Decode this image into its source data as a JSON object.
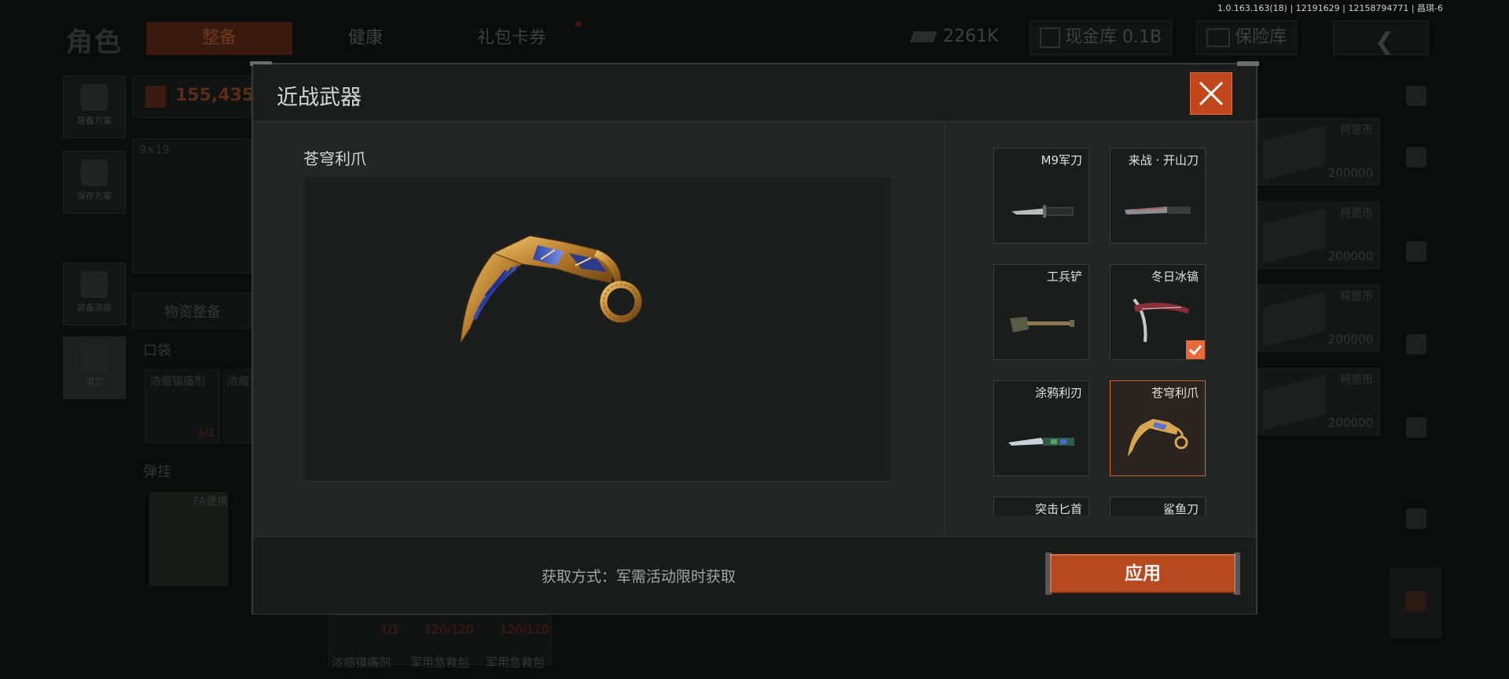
{
  "version_text": "1.0.163.163(18) | 12191629 | 12158794771 | 昌琪-6",
  "background": {
    "title": "角色",
    "tabs": [
      {
        "label": "整备",
        "active": true
      },
      {
        "label": "健康",
        "active": false
      },
      {
        "label": "礼包卡券",
        "active": false
      }
    ],
    "resources": {
      "ticket": "2261K",
      "cash_vault": "现金库 0.1B",
      "safe": "保险库"
    },
    "currency_value": "155,435",
    "ammo_label": "9×19",
    "side_buttons": [
      "装备方案",
      "保存方案",
      "装备涂装",
      "潜力"
    ],
    "supply_tab": "物资整备",
    "pocket_label": "口袋",
    "pocket_items": [
      {
        "name": "浓缩镇痛剂",
        "count": "1/1"
      },
      {
        "name": "浓缩",
        "count": ""
      }
    ],
    "rig_label": "弹挂",
    "rig_name": "FA便携",
    "bottom_items": [
      {
        "name": "浓缩镇痛剂",
        "count": "1/1"
      },
      {
        "name": "军用急救包",
        "count": "120/120"
      },
      {
        "name": "军用急救包",
        "count": "120/120"
      }
    ],
    "money_cards": [
      {
        "label": "柯恩币",
        "value": "200000"
      },
      {
        "label": "柯恩币",
        "value": "200000"
      },
      {
        "label": "柯恩币",
        "value": "200000"
      },
      {
        "label": "柯恩币",
        "value": "200000"
      }
    ]
  },
  "modal": {
    "title": "近战武器",
    "selected_name": "苍穹利爪",
    "weapons": [
      {
        "name": "M9军刀",
        "thumb": "bayonet"
      },
      {
        "name": "来战 · 开山刀",
        "thumb": "machete"
      },
      {
        "name": "工兵铲",
        "thumb": "shovel"
      },
      {
        "name": "冬日冰镐",
        "thumb": "icepick",
        "equipped": true
      },
      {
        "name": "涂鸦利刃",
        "thumb": "graffiti-knife"
      },
      {
        "name": "苍穹利爪",
        "thumb": "karambit",
        "selected": true
      },
      {
        "name": "突击匕首",
        "thumb": "dagger"
      },
      {
        "name": "鲨鱼刀",
        "thumb": "shark-knife"
      }
    ],
    "source_text": "获取方式：军需活动限时获取",
    "apply_label": "应用"
  },
  "colors": {
    "accent": "#c3451c",
    "selected_border": "#d2602e",
    "check": "#e86a39"
  }
}
